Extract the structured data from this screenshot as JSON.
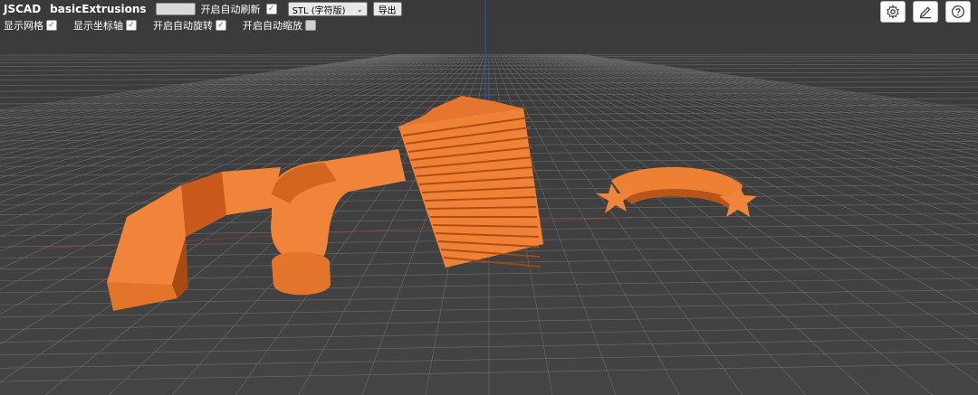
{
  "app": {
    "name": "JSCAD",
    "design": "basicExtrusions"
  },
  "toolbar": {
    "auto_reload_label": "开启自动刷新",
    "auto_reload_checked": true,
    "export_format": "STL (字符版)",
    "export_button": "导出"
  },
  "options": [
    {
      "label": "显示网格",
      "checked": true
    },
    {
      "label": "显示坐标轴",
      "checked": true
    },
    {
      "label": "开启自动旋转",
      "checked": true
    },
    {
      "label": "开启自动缩放",
      "checked": false
    }
  ],
  "icons": [
    "gear-icon",
    "edit-icon",
    "help-icon"
  ],
  "colors": {
    "background": "#3b3b3b",
    "grid": "#9a9a9a",
    "model": "#e9792c",
    "checkbox": "#1a73e8"
  }
}
